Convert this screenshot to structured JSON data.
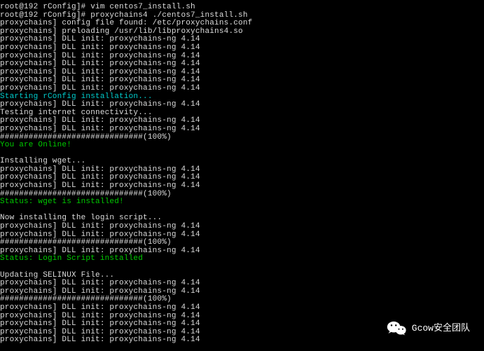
{
  "terminal": {
    "lines": [
      {
        "text": "root@192 rConfig]# vim centos7_install.sh",
        "class": "white"
      },
      {
        "text": "root@192 rConfig]# proxychains4 ./centos7_install.sh",
        "class": "white"
      },
      {
        "text": "proxychains] config file found: /etc/proxychains.conf",
        "class": "white"
      },
      {
        "text": "proxychains] preloading /usr/lib/libproxychains4.so",
        "class": "white"
      },
      {
        "text": "proxychains] DLL init: proxychains-ng 4.14",
        "class": "white"
      },
      {
        "text": "proxychains] DLL init: proxychains-ng 4.14",
        "class": "white"
      },
      {
        "text": "proxychains] DLL init: proxychains-ng 4.14",
        "class": "white"
      },
      {
        "text": "proxychains] DLL init: proxychains-ng 4.14",
        "class": "white"
      },
      {
        "text": "proxychains] DLL init: proxychains-ng 4.14",
        "class": "white"
      },
      {
        "text": "proxychains] DLL init: proxychains-ng 4.14",
        "class": "white"
      },
      {
        "text": "proxychains] DLL init: proxychains-ng 4.14",
        "class": "white"
      },
      {
        "text": "Starting rConfig installation...",
        "class": "cyan"
      },
      {
        "text": "proxychains] DLL init: proxychains-ng 4.14",
        "class": "white"
      },
      {
        "text": "Testing internet connectivity...",
        "class": "white"
      },
      {
        "text": "proxychains] DLL init: proxychains-ng 4.14",
        "class": "white"
      },
      {
        "text": "proxychains] DLL init: proxychains-ng 4.14",
        "class": "white"
      },
      {
        "text": "##############################(100%)",
        "class": "white"
      },
      {
        "text": "You are Online!",
        "class": "green"
      },
      {
        "text": "",
        "class": "white"
      },
      {
        "text": "Installing wget...",
        "class": "white"
      },
      {
        "text": "proxychains] DLL init: proxychains-ng 4.14",
        "class": "white"
      },
      {
        "text": "proxychains] DLL init: proxychains-ng 4.14",
        "class": "white"
      },
      {
        "text": "proxychains] DLL init: proxychains-ng 4.14",
        "class": "white"
      },
      {
        "text": "##############################(100%)",
        "class": "white"
      },
      {
        "text": "Status: wget is installed!",
        "class": "green"
      },
      {
        "text": "",
        "class": "white"
      },
      {
        "text": "Now installing the login script...",
        "class": "white"
      },
      {
        "text": "proxychains] DLL init: proxychains-ng 4.14",
        "class": "white"
      },
      {
        "text": "proxychains] DLL init: proxychains-ng 4.14",
        "class": "white"
      },
      {
        "text": "##############################(100%)",
        "class": "white"
      },
      {
        "text": "proxychains] DLL init: proxychains-ng 4.14",
        "class": "white"
      },
      {
        "text": "Status: Login Script installed",
        "class": "green"
      },
      {
        "text": "",
        "class": "white"
      },
      {
        "text": "Updating SELINUX File...",
        "class": "white"
      },
      {
        "text": "proxychains] DLL init: proxychains-ng 4.14",
        "class": "white"
      },
      {
        "text": "proxychains] DLL init: proxychains-ng 4.14",
        "class": "white"
      },
      {
        "text": "##############################(100%)",
        "class": "white"
      },
      {
        "text": "proxychains] DLL init: proxychains-ng 4.14",
        "class": "white"
      },
      {
        "text": "proxychains] DLL init: proxychains-ng 4.14",
        "class": "white"
      },
      {
        "text": "proxychains] DLL init: proxychains-ng 4.14",
        "class": "white"
      },
      {
        "text": "proxychains] DLL init: proxychains-ng 4.14",
        "class": "white"
      },
      {
        "text": "proxychains] DLL init: proxychains-ng 4.14",
        "class": "white"
      }
    ]
  },
  "watermark": {
    "text": "Gcow安全团队"
  }
}
